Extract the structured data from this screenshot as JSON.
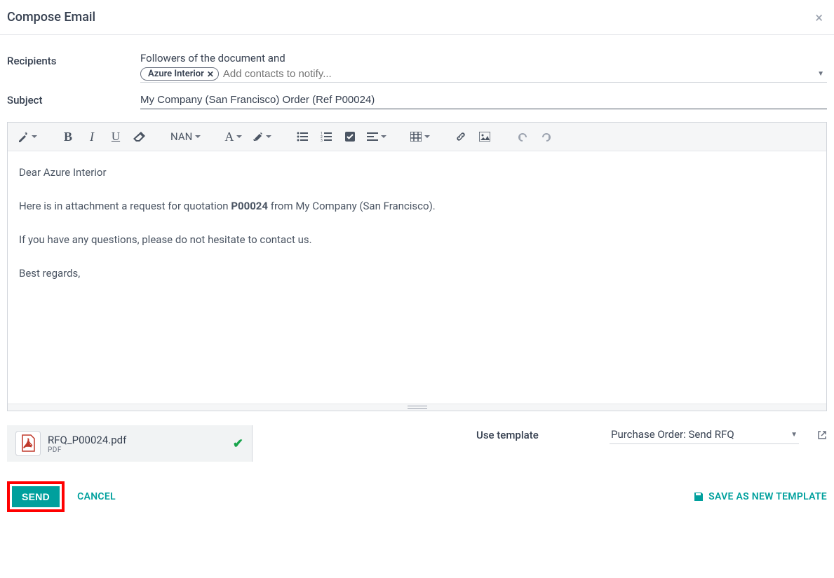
{
  "header": {
    "title": "Compose Email"
  },
  "fields": {
    "recipients_label": "Recipients",
    "followers_text": "Followers of the document and",
    "tag_name": "Azure Interior",
    "recipients_placeholder": "Add contacts to notify...",
    "subject_label": "Subject",
    "subject_value": "My Company (San Francisco) Order (Ref P00024)"
  },
  "toolbar": {
    "font_size_label": "NAN"
  },
  "body": {
    "greeting": "Dear Azure Interior",
    "line1_a": "Here is in attachment a request for quotation ",
    "line1_b": "P00024",
    "line1_c": " from My Company (San Francisco).",
    "line2": "If you have any questions, please do not hesitate to contact us.",
    "closing": "Best regards,"
  },
  "attachment": {
    "filename": "RFQ_P00024.pdf",
    "ext": "PDF"
  },
  "template": {
    "label": "Use template",
    "value": "Purchase Order: Send RFQ"
  },
  "footer": {
    "send": "SEND",
    "cancel": "CANCEL",
    "save_template": "SAVE AS NEW TEMPLATE"
  }
}
